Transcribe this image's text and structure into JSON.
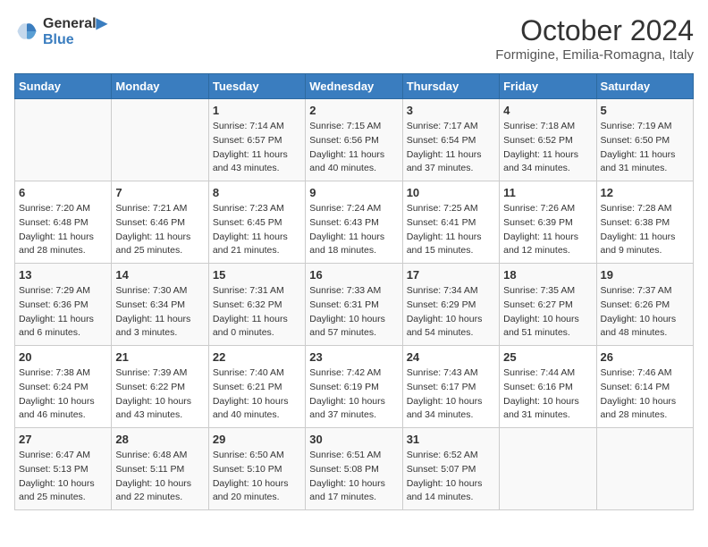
{
  "logo": {
    "line1": "General",
    "line2": "Blue"
  },
  "title": "October 2024",
  "subtitle": "Formigine, Emilia-Romagna, Italy",
  "days_of_week": [
    "Sunday",
    "Monday",
    "Tuesday",
    "Wednesday",
    "Thursday",
    "Friday",
    "Saturday"
  ],
  "weeks": [
    [
      {
        "day": "",
        "info": ""
      },
      {
        "day": "",
        "info": ""
      },
      {
        "day": "1",
        "info": "Sunrise: 7:14 AM\nSunset: 6:57 PM\nDaylight: 11 hours and 43 minutes."
      },
      {
        "day": "2",
        "info": "Sunrise: 7:15 AM\nSunset: 6:56 PM\nDaylight: 11 hours and 40 minutes."
      },
      {
        "day": "3",
        "info": "Sunrise: 7:17 AM\nSunset: 6:54 PM\nDaylight: 11 hours and 37 minutes."
      },
      {
        "day": "4",
        "info": "Sunrise: 7:18 AM\nSunset: 6:52 PM\nDaylight: 11 hours and 34 minutes."
      },
      {
        "day": "5",
        "info": "Sunrise: 7:19 AM\nSunset: 6:50 PM\nDaylight: 11 hours and 31 minutes."
      }
    ],
    [
      {
        "day": "6",
        "info": "Sunrise: 7:20 AM\nSunset: 6:48 PM\nDaylight: 11 hours and 28 minutes."
      },
      {
        "day": "7",
        "info": "Sunrise: 7:21 AM\nSunset: 6:46 PM\nDaylight: 11 hours and 25 minutes."
      },
      {
        "day": "8",
        "info": "Sunrise: 7:23 AM\nSunset: 6:45 PM\nDaylight: 11 hours and 21 minutes."
      },
      {
        "day": "9",
        "info": "Sunrise: 7:24 AM\nSunset: 6:43 PM\nDaylight: 11 hours and 18 minutes."
      },
      {
        "day": "10",
        "info": "Sunrise: 7:25 AM\nSunset: 6:41 PM\nDaylight: 11 hours and 15 minutes."
      },
      {
        "day": "11",
        "info": "Sunrise: 7:26 AM\nSunset: 6:39 PM\nDaylight: 11 hours and 12 minutes."
      },
      {
        "day": "12",
        "info": "Sunrise: 7:28 AM\nSunset: 6:38 PM\nDaylight: 11 hours and 9 minutes."
      }
    ],
    [
      {
        "day": "13",
        "info": "Sunrise: 7:29 AM\nSunset: 6:36 PM\nDaylight: 11 hours and 6 minutes."
      },
      {
        "day": "14",
        "info": "Sunrise: 7:30 AM\nSunset: 6:34 PM\nDaylight: 11 hours and 3 minutes."
      },
      {
        "day": "15",
        "info": "Sunrise: 7:31 AM\nSunset: 6:32 PM\nDaylight: 11 hours and 0 minutes."
      },
      {
        "day": "16",
        "info": "Sunrise: 7:33 AM\nSunset: 6:31 PM\nDaylight: 10 hours and 57 minutes."
      },
      {
        "day": "17",
        "info": "Sunrise: 7:34 AM\nSunset: 6:29 PM\nDaylight: 10 hours and 54 minutes."
      },
      {
        "day": "18",
        "info": "Sunrise: 7:35 AM\nSunset: 6:27 PM\nDaylight: 10 hours and 51 minutes."
      },
      {
        "day": "19",
        "info": "Sunrise: 7:37 AM\nSunset: 6:26 PM\nDaylight: 10 hours and 48 minutes."
      }
    ],
    [
      {
        "day": "20",
        "info": "Sunrise: 7:38 AM\nSunset: 6:24 PM\nDaylight: 10 hours and 46 minutes."
      },
      {
        "day": "21",
        "info": "Sunrise: 7:39 AM\nSunset: 6:22 PM\nDaylight: 10 hours and 43 minutes."
      },
      {
        "day": "22",
        "info": "Sunrise: 7:40 AM\nSunset: 6:21 PM\nDaylight: 10 hours and 40 minutes."
      },
      {
        "day": "23",
        "info": "Sunrise: 7:42 AM\nSunset: 6:19 PM\nDaylight: 10 hours and 37 minutes."
      },
      {
        "day": "24",
        "info": "Sunrise: 7:43 AM\nSunset: 6:17 PM\nDaylight: 10 hours and 34 minutes."
      },
      {
        "day": "25",
        "info": "Sunrise: 7:44 AM\nSunset: 6:16 PM\nDaylight: 10 hours and 31 minutes."
      },
      {
        "day": "26",
        "info": "Sunrise: 7:46 AM\nSunset: 6:14 PM\nDaylight: 10 hours and 28 minutes."
      }
    ],
    [
      {
        "day": "27",
        "info": "Sunrise: 6:47 AM\nSunset: 5:13 PM\nDaylight: 10 hours and 25 minutes."
      },
      {
        "day": "28",
        "info": "Sunrise: 6:48 AM\nSunset: 5:11 PM\nDaylight: 10 hours and 22 minutes."
      },
      {
        "day": "29",
        "info": "Sunrise: 6:50 AM\nSunset: 5:10 PM\nDaylight: 10 hours and 20 minutes."
      },
      {
        "day": "30",
        "info": "Sunrise: 6:51 AM\nSunset: 5:08 PM\nDaylight: 10 hours and 17 minutes."
      },
      {
        "day": "31",
        "info": "Sunrise: 6:52 AM\nSunset: 5:07 PM\nDaylight: 10 hours and 14 minutes."
      },
      {
        "day": "",
        "info": ""
      },
      {
        "day": "",
        "info": ""
      }
    ]
  ]
}
